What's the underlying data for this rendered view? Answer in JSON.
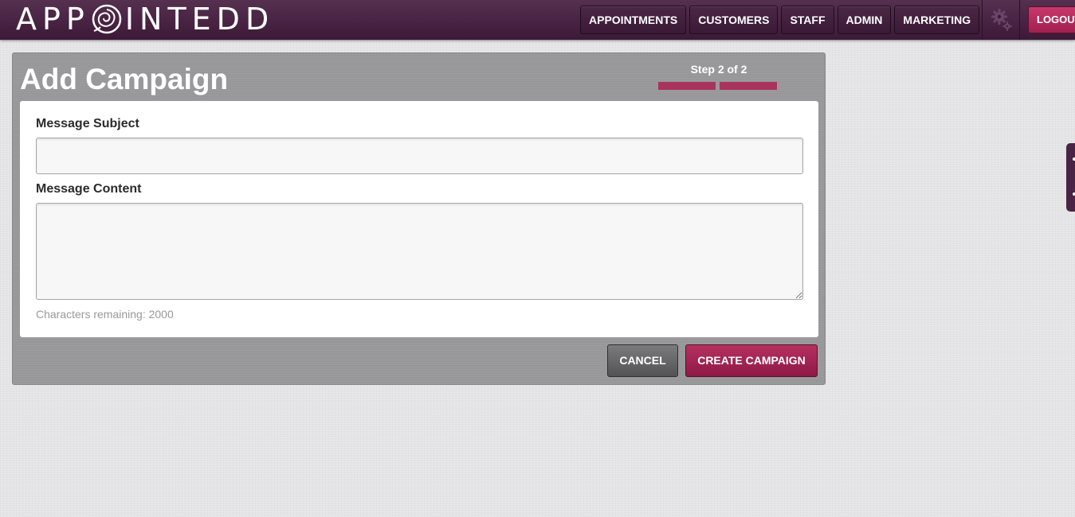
{
  "header": {
    "logo_text_left": "APP",
    "logo_text_right": "INTEDD",
    "nav": [
      {
        "label": "APPOINTMENTS"
      },
      {
        "label": "CUSTOMERS"
      },
      {
        "label": "STAFF"
      },
      {
        "label": "ADMIN"
      },
      {
        "label": "MARKETING"
      }
    ],
    "settings_icon": "gear-icon",
    "logout_label": "LOGOUT"
  },
  "panel": {
    "title": "Add Campaign",
    "step_text": "Step 2 of 2",
    "step_current": 2,
    "step_total": 2
  },
  "form": {
    "subject_label": "Message Subject",
    "subject_value": "",
    "content_label": "Message Content",
    "content_value": "",
    "chars_remaining": "Characters remaining: 2000"
  },
  "actions": {
    "cancel_label": "CANCEL",
    "create_label": "CREATE CAMPAIGN"
  },
  "colors": {
    "header_bg": "#4a2444",
    "accent": "#a8345e",
    "panel_bg": "#97979a",
    "cancel_bg": "#6a6a6c"
  }
}
